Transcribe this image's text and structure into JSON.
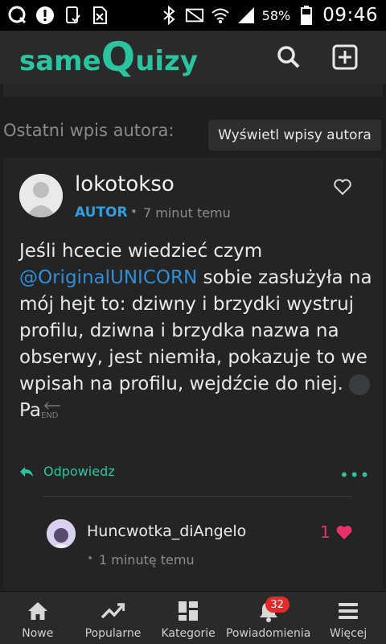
{
  "status_bar": {
    "battery_percent": "58%",
    "time": "09:46"
  },
  "app_bar": {
    "logo_prefix": "same",
    "logo_q": "Q",
    "logo_suffix": "uizy"
  },
  "section": {
    "label": "Ostatni wpis autora:",
    "view_posts_button": "Wyświetl wpisy autora"
  },
  "post": {
    "author": "lokotokso",
    "badge": "AUTOR",
    "separator": "•",
    "time": "7 minut temu",
    "body_1": "Jeśli hcecie wiedzieć czym ",
    "mention": "@OriginalUNICORN",
    "body_2": " sobie zasłużyła na mój hejt to: dziwny i brzydki wystruj profilu, dziwna i brzydka nazwa na obserwy, jest niemiła, pokazuje to we wpisah na profilu, wejdźcie do niej. ",
    "body_3": "Pa",
    "end_glyph": "END",
    "reply_label": "Odpowiedz",
    "more_label": "•••"
  },
  "comment": {
    "author": "Huncwotka_diAngelo",
    "likes": "1",
    "separator": "•",
    "time": "1 minutę temu"
  },
  "bottom_nav": {
    "items": [
      {
        "label": "Nowe",
        "icon": "home-icon"
      },
      {
        "label": "Popularne",
        "icon": "trending-icon"
      },
      {
        "label": "Kategorie",
        "icon": "grid-icon"
      },
      {
        "label": "Powiadomienia",
        "icon": "bell-icon",
        "badge": "32"
      },
      {
        "label": "Więcej",
        "icon": "menu-icon"
      }
    ]
  },
  "colors": {
    "accent": "#2bc4a0",
    "link": "#2f8fd8",
    "heart": "#e8336a",
    "badge": "#e52a2a"
  }
}
